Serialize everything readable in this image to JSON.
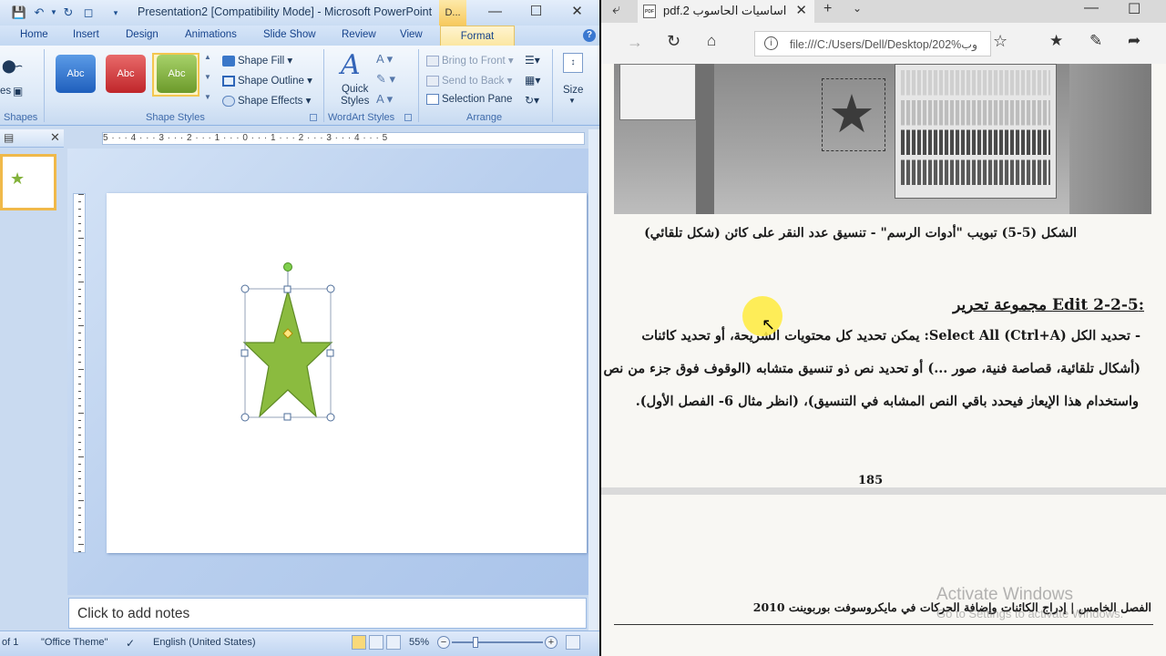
{
  "ppt": {
    "title": "Presentation2 [Compatibility Mode] - Microsoft PowerPoint",
    "contextual_tab": "D...",
    "tabs": [
      "Home",
      "Insert",
      "Design",
      "Animations",
      "Slide Show",
      "Review",
      "View"
    ],
    "active_tab": "Format",
    "left_cut": {
      "shapes_label": "Shapes",
      "es": "es"
    },
    "shape_styles": {
      "samples": [
        "Abc",
        "Abc",
        "Abc"
      ],
      "fill": "Shape Fill",
      "outline": "Shape Outline",
      "effects": "Shape Effects",
      "group_label": "Shape Styles"
    },
    "wordart": {
      "quick_styles": "Quick\nStyles",
      "group_label": "WordArt Styles"
    },
    "arrange": {
      "bring_front": "Bring to Front",
      "send_back": "Send to Back",
      "selection_pane": "Selection Pane",
      "group_label": "Arrange"
    },
    "size_label": "Size",
    "ruler_top": "5 · · · 4 · · · 3 · · · 2 · · · 1 · · · 0 · · · 1 · · · 2 · · · 3 · · · 4 · · · 5",
    "notes_placeholder": "Click to add notes",
    "status": {
      "slide": "of 1",
      "theme": "\"Office Theme\"",
      "language": "English (United States)",
      "zoom": "55%"
    },
    "colors": {
      "star_fill": "#8bbb3f",
      "star_stroke": "#5e8a25",
      "accent_orange": "#f0b94a"
    }
  },
  "edge": {
    "tab_title": "اساسيات الحاسوب pdf.2",
    "url": "file:///C:/Users/Dell/Desktop/202%وب",
    "caption": "الشكل (5-5) تبويب \"أدوات الرسم\" - تنسيق عدد النقر على كائن (شكل تلقائي)",
    "heading": ":Edit 2-2-5 مجموعة تحرير",
    "line1": "- تحديد الكل Select All (Ctrl+A): يمكن تحديد كل محتويات الشريحة، أو تحديد كائنات",
    "line2": "(أشكال تلقائية، قصاصة فنية، صور ...) أو تحديد نص ذو تنسيق متشابه (الوقوف فوق جزء من نص",
    "line3": "واستخدام هذا الإيعاز فيحدد باقي النص المشابه في التنسيق)، (انظر مثال 6- الفصل الأول).",
    "page_number": "185",
    "footer": "الفصل الخامس | إدراج الكائنات وإضافة الحركات في مايكروسوفت بوربوينت 2010",
    "watermark_title": "Activate Windows",
    "watermark_sub": "Go to Settings to activate Windows."
  }
}
